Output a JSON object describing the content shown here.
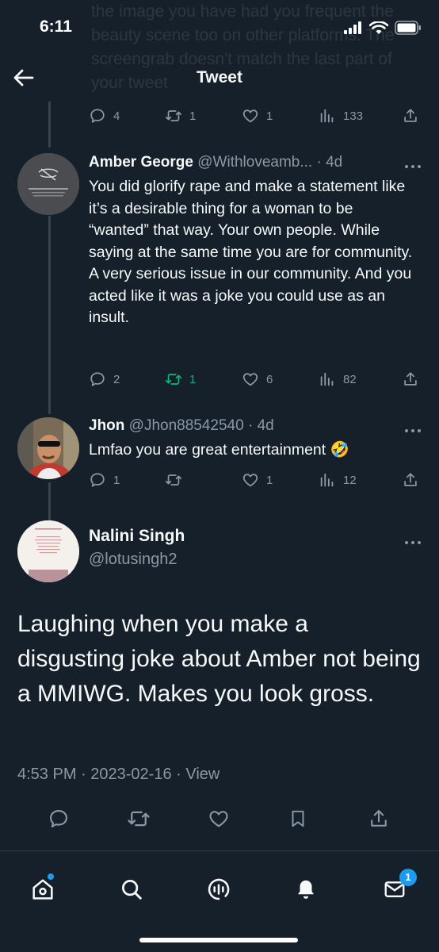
{
  "status_bar": {
    "time": "6:11",
    "ghost_text": "the image you have had you frequent the beauty scene too on other platforms. The screengrab doesn't match the last part of your tweet"
  },
  "header": {
    "title": "Tweet"
  },
  "top_actions": {
    "replies": "4",
    "retweets": "1",
    "likes": "1",
    "views": "133"
  },
  "replies": [
    {
      "name": "Amber George",
      "handle": "@Withloveamb...",
      "time": "· 4d",
      "avatar_label": "Sensitive content",
      "text": "You did glorify rape and make a statement like it’s a desirable thing for a woman to be “wanted” that way. Your own people. While saying at the same time you are for community. A very serious issue in our community. And you acted like it was a joke you could use as an insult.",
      "replies": "2",
      "retweets": "1",
      "likes": "6",
      "views": "82"
    },
    {
      "name": "Jhon",
      "handle": "@Jhon88542540",
      "time": "· 4d",
      "text": "Lmfao you are great entertainment 🤣",
      "replies": "1",
      "retweets": "",
      "likes": "1",
      "views": "12"
    }
  ],
  "main_tweet": {
    "name": "Nalini Singh",
    "handle": "@lotusingh2",
    "text": "Laughing when you make a disgusting joke about Amber not being a MMIWG. Makes you look gross.",
    "meta": "4:53 PM · 2023-02-16 · View"
  },
  "tabbar": {
    "messages_badge": "1"
  },
  "colors": {
    "background": "#15202b",
    "muted": "#8b98a5",
    "retweet_active": "#00ba7c",
    "accent": "#1d9bf0"
  }
}
